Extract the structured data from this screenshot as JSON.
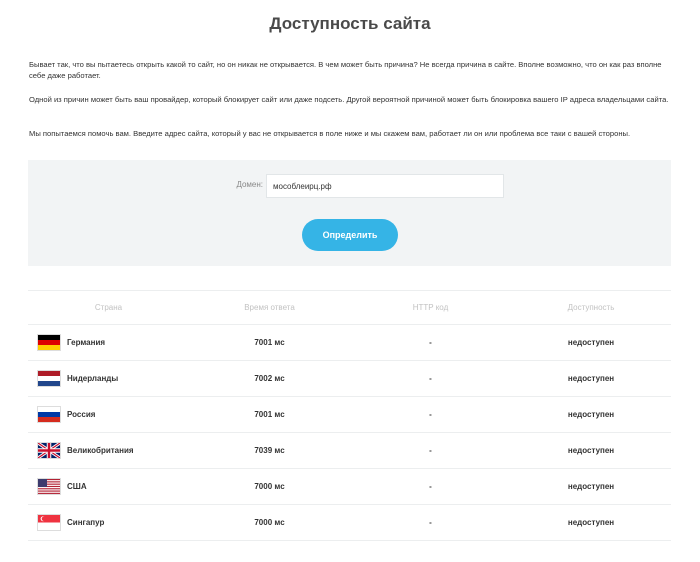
{
  "page": {
    "title": "Доступность сайта",
    "intro": [
      "Бывает так, что вы пытаетесь открыть какой то сайт, но он никак не открывается. В чем может быть причина? Не всегда причина в сайте. Вполне возможно, что он как раз вполне себе даже работает.",
      "Одной из причин может быть ваш провайдер, который блокирует сайт или даже подсеть. Другой вероятной причиной может быть блокировка вашего IP адреса владельцами сайта.",
      "Мы попытаемся помочь вам. Введите адрес сайта, который у вас не открывается в поле ниже и мы скажем вам, работает ли он или проблема все таки с вашей стороны."
    ]
  },
  "form": {
    "domain_label": "Домен:",
    "domain_value": "мособлеирц.рф",
    "submit_label": "Определить"
  },
  "table": {
    "headers": [
      "Страна",
      "Время ответа",
      "HTTP код",
      "Доступность"
    ],
    "rows": [
      {
        "flag": "germany-flag",
        "country": "Германия",
        "time": "7001 мс",
        "http": "-",
        "status": "недоступен"
      },
      {
        "flag": "netherlands-flag",
        "country": "Нидерланды",
        "time": "7002 мс",
        "http": "-",
        "status": "недоступен"
      },
      {
        "flag": "russia-flag",
        "country": "Россия",
        "time": "7001 мс",
        "http": "-",
        "status": "недоступен"
      },
      {
        "flag": "uk-flag",
        "country": "Великобритания",
        "time": "7039 мс",
        "http": "-",
        "status": "недоступен"
      },
      {
        "flag": "usa-flag",
        "country": "США",
        "time": "7000 мс",
        "http": "-",
        "status": "недоступен"
      },
      {
        "flag": "singapore-flag",
        "country": "Сингапур",
        "time": "7000 мс",
        "http": "-",
        "status": "недоступен"
      }
    ]
  },
  "colors": {
    "accent": "#35b4e6",
    "status_down": "#e60000",
    "form_bg": "#f2f4f5"
  }
}
